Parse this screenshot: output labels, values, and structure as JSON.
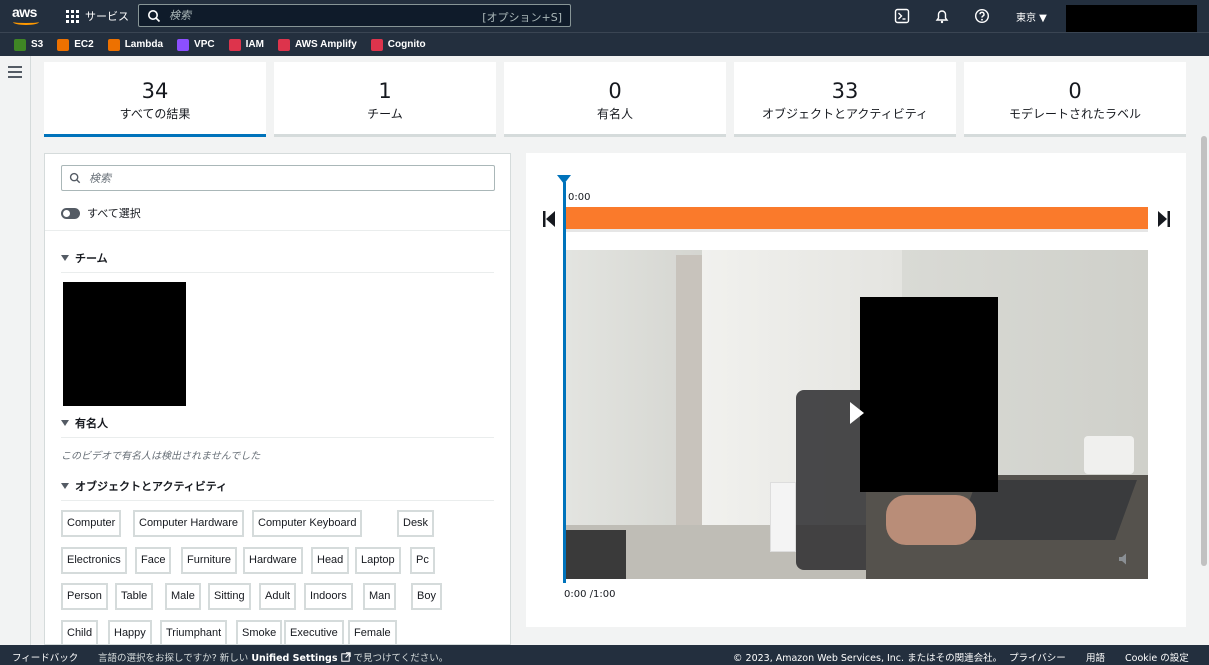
{
  "nav": {
    "logo_text": "aws",
    "services_label": "サービス",
    "search_placeholder": "検索",
    "search_shortcut": "[オプション+S]",
    "region": "東京 ▼"
  },
  "favorites": [
    {
      "label": "S3",
      "color": "#3f8624"
    },
    {
      "label": "EC2",
      "color": "#ed7100"
    },
    {
      "label": "Lambda",
      "color": "#ed7100"
    },
    {
      "label": "VPC",
      "color": "#8c4fff"
    },
    {
      "label": "IAM",
      "color": "#dd344c"
    },
    {
      "label": "AWS Amplify",
      "color": "#dd344c"
    },
    {
      "label": "Cognito",
      "color": "#dd344c"
    }
  ],
  "stats": [
    {
      "value": "34",
      "label": "すべての結果"
    },
    {
      "value": "1",
      "label": "チーム"
    },
    {
      "value": "0",
      "label": "有名人"
    },
    {
      "value": "33",
      "label": "オブジェクトとアクティビティ"
    },
    {
      "value": "0",
      "label": "モデレートされたラベル"
    }
  ],
  "panel": {
    "search_placeholder": "検索",
    "select_all": "すべて選択",
    "team_heading": "チーム",
    "celeb_heading": "有名人",
    "no_celeb_text": "このビデオで有名人は検出されませんでした",
    "objects_heading": "オブジェクトとアクティビティ",
    "tags": [
      "Computer",
      "Computer Hardware",
      "Computer Keyboard",
      "Desk",
      "Electronics",
      "Face",
      "Furniture",
      "Hardware",
      "Head",
      "Laptop",
      "Pc",
      "Person",
      "Table",
      "Male",
      "Sitting",
      "Adult",
      "Indoors",
      "Man",
      "Boy",
      "Child",
      "Happy",
      "Triumphant",
      "Smoke",
      "Executive",
      "Female"
    ]
  },
  "player": {
    "time_start": "0:00",
    "time_display": "0:00 /1:00",
    "progress": 1.0,
    "accent": "#fa7a2b",
    "playhead_color": "#0073bb"
  },
  "footer": {
    "feedback": "フィードバック",
    "message_prefix": "言語の選択をお探しですか? 新しい",
    "message_link": "Unified Settings",
    "message_suffix": " で見つけてください。",
    "copyright": "© 2023, Amazon Web Services, Inc. またはその関連会社。",
    "privacy": "プライバシー",
    "terms": "用語",
    "cookie": "Cookie の設定"
  }
}
